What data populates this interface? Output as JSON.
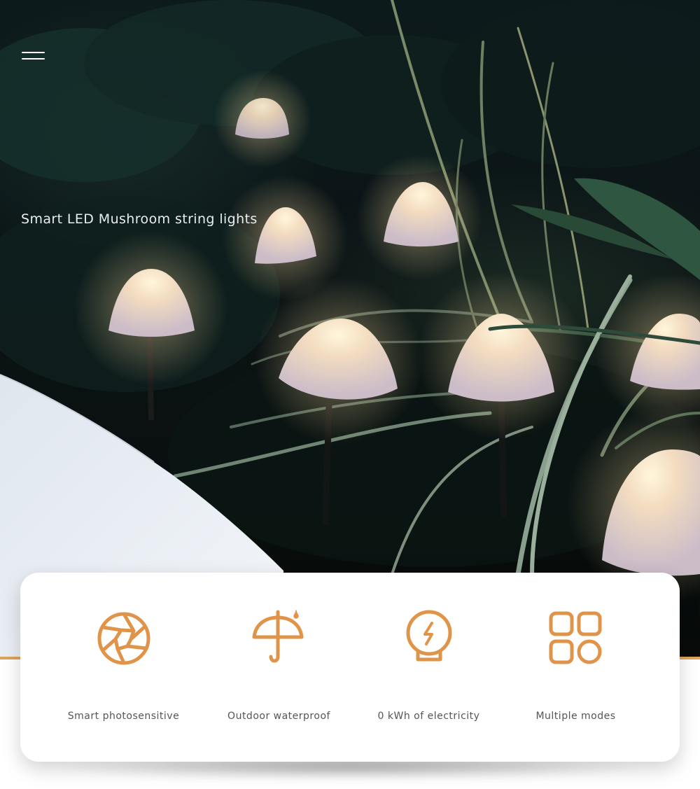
{
  "hero": {
    "title": "Smart LED Mushroom string lights"
  },
  "colors": {
    "accent": "#e0a25b",
    "icon": "#e0944a",
    "card_background": "#ffffff",
    "label_text": "#555555"
  },
  "features": [
    {
      "icon": "aperture-icon",
      "label": "Smart photosensitive"
    },
    {
      "icon": "umbrella-icon",
      "label": "Outdoor waterproof"
    },
    {
      "icon": "lightbulb-bolt-icon",
      "label": "0 kWh of electricity"
    },
    {
      "icon": "grid-modes-icon",
      "label": "Multiple modes"
    }
  ]
}
